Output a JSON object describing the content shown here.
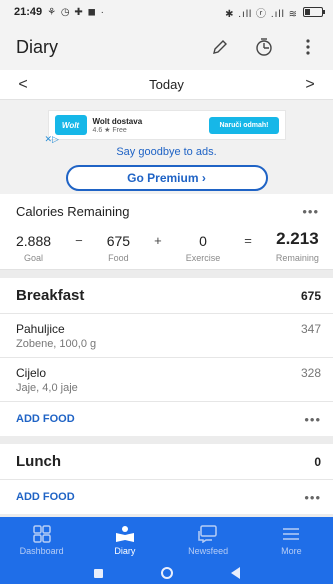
{
  "status_bar": {
    "time": "21:49",
    "left_icons": "⚘ ◷ ✚ ◼ ·",
    "right_icons": "✱ .ıll ⓡ .ıll ≋",
    "battery_level": 0.3
  },
  "app_bar": {
    "title": "Diary"
  },
  "date_nav": {
    "label": "Today",
    "prev": "<",
    "next": ">"
  },
  "ad": {
    "brand": "Wolt",
    "name": "Wolt dostava",
    "rating": "4.6 ★ Free",
    "cta": "Naruči odmah!",
    "caption": "Say goodbye to ads.",
    "premium_button": "Go Premium ›"
  },
  "calories": {
    "title": "Calories Remaining",
    "goal": {
      "value": "2.888",
      "label": "Goal"
    },
    "food": {
      "value": "675",
      "label": "Food"
    },
    "exercise": {
      "value": "0",
      "label": "Exercise"
    },
    "remaining": {
      "value": "2.213",
      "label": "Remaining"
    },
    "op_minus": "−",
    "op_plus": "+",
    "op_equals": "="
  },
  "meals": [
    {
      "title": "Breakfast",
      "total": "675",
      "items": [
        {
          "name": "Pahuljice",
          "desc": "Zobene, 100,0 g",
          "cal": "347"
        },
        {
          "name": "Cijelo",
          "desc": "Jaje, 4,0 jaje",
          "cal": "328"
        }
      ],
      "add_label": "ADD FOOD"
    },
    {
      "title": "Lunch",
      "total": "0",
      "items": [],
      "add_label": "ADD FOOD"
    }
  ],
  "peek_close": "×",
  "bottom_nav": [
    {
      "label": "Dashboard",
      "icon": "dashboard-icon"
    },
    {
      "label": "Diary",
      "icon": "diary-icon",
      "active": true
    },
    {
      "label": "Newsfeed",
      "icon": "newsfeed-icon"
    },
    {
      "label": "More",
      "icon": "menu-icon"
    }
  ],
  "colors": {
    "accent": "#1f63c5",
    "nav": "#1f6ee8",
    "wolt": "#16b7e8"
  }
}
